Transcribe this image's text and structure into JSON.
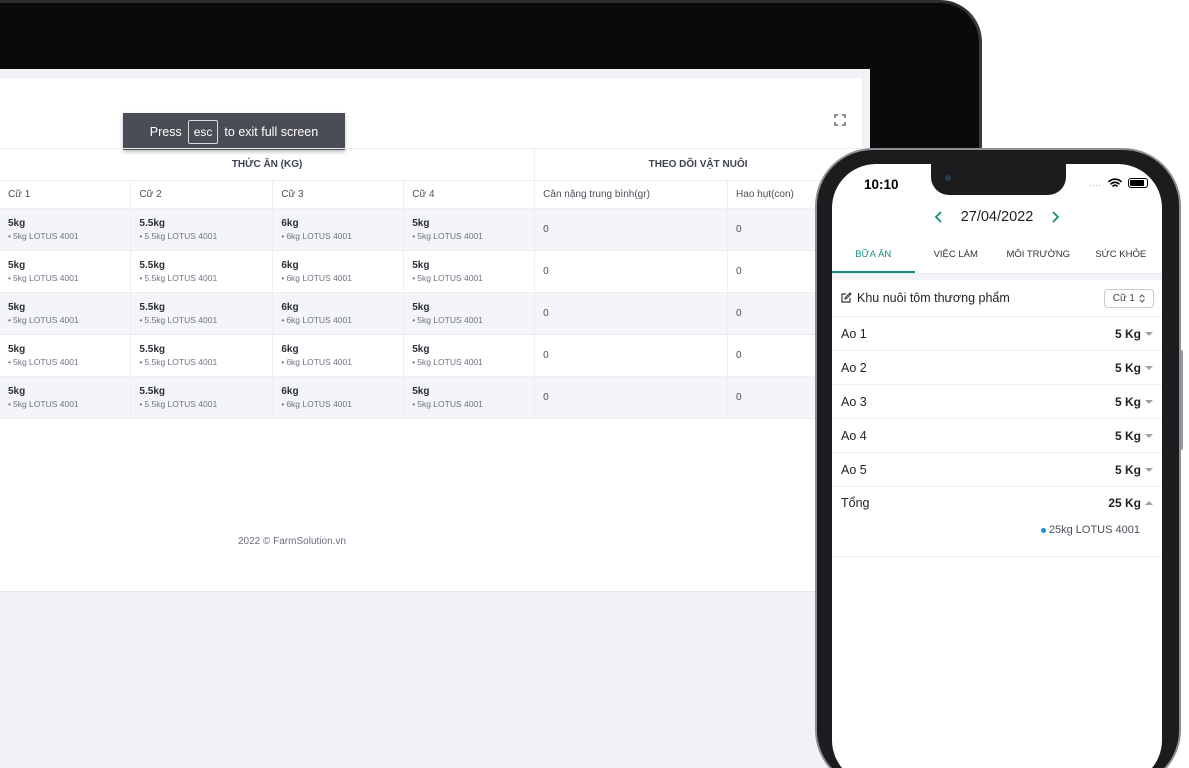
{
  "fullscreen_toast": {
    "press": "Press",
    "key": "esc",
    "suffix": "to exit full screen"
  },
  "table": {
    "group_feed": "THỨC ĂN (KG)",
    "group_tracking": "THEO DÕI VẬT NUÔI",
    "columns": [
      "Cữ 1",
      "Cữ 2",
      "Cữ 3",
      "Cữ 4",
      "Cân nặng trung bình(gr)",
      "Hao hụt(con)"
    ],
    "rows": [
      {
        "c1": "5kg",
        "c1s": "5kg LOTUS 4001",
        "c2": "5.5kg",
        "c2s": "5.5kg LOTUS 4001",
        "c3": "6kg",
        "c3s": "6kg LOTUS 4001",
        "c4": "5kg",
        "c4s": "5kg LOTUS 4001",
        "weight": "0",
        "loss": "0"
      },
      {
        "c1": "5kg",
        "c1s": "5kg LOTUS 4001",
        "c2": "5.5kg",
        "c2s": "5.5kg LOTUS 4001",
        "c3": "6kg",
        "c3s": "6kg LOTUS 4001",
        "c4": "5kg",
        "c4s": "5kg LOTUS 4001",
        "weight": "0",
        "loss": "0"
      },
      {
        "c1": "5kg",
        "c1s": "5kg LOTUS 4001",
        "c2": "5.5kg",
        "c2s": "5.5kg LOTUS 4001",
        "c3": "6kg",
        "c3s": "6kg LOTUS 4001",
        "c4": "5kg",
        "c4s": "5kg LOTUS 4001",
        "weight": "0",
        "loss": "0"
      },
      {
        "c1": "5kg",
        "c1s": "5kg LOTUS 4001",
        "c2": "5.5kg",
        "c2s": "5.5kg LOTUS 4001",
        "c3": "6kg",
        "c3s": "6kg LOTUS 4001",
        "c4": "5kg",
        "c4s": "5kg LOTUS 4001",
        "weight": "0",
        "loss": "0"
      },
      {
        "c1": "5kg",
        "c1s": "5kg LOTUS 4001",
        "c2": "5.5kg",
        "c2s": "5.5kg LOTUS 4001",
        "c3": "6kg",
        "c3s": "6kg LOTUS 4001",
        "c4": "5kg",
        "c4s": "5kg LOTUS 4001",
        "weight": "0",
        "loss": "0"
      }
    ]
  },
  "footer": "2022 © FarmSolution.vn",
  "phone": {
    "status_time": "10:10",
    "status_dots": "....",
    "date": "27/04/2022",
    "tabs": [
      "BỮA ĂN",
      "VIỆC LÀM",
      "MÔI TRƯỜNG",
      "SỨC KHỎE"
    ],
    "active_tab": 0,
    "farm_title": "Khu nuôi tôm thương phẩm",
    "cage_select": "Cữ 1",
    "ponds": [
      {
        "name": "Ao 1",
        "value": "5 Kg"
      },
      {
        "name": "Ao 2",
        "value": "5 Kg"
      },
      {
        "name": "Ao 3",
        "value": "5 Kg"
      },
      {
        "name": "Ao 4",
        "value": "5 Kg"
      },
      {
        "name": "Ao 5",
        "value": "5 Kg"
      }
    ],
    "total_label": "Tổng",
    "total_value": "25 Kg",
    "total_detail": "25kg LOTUS 4001"
  },
  "colors": {
    "accent": "#1a8a7c",
    "bullet": "#1e90d6"
  }
}
